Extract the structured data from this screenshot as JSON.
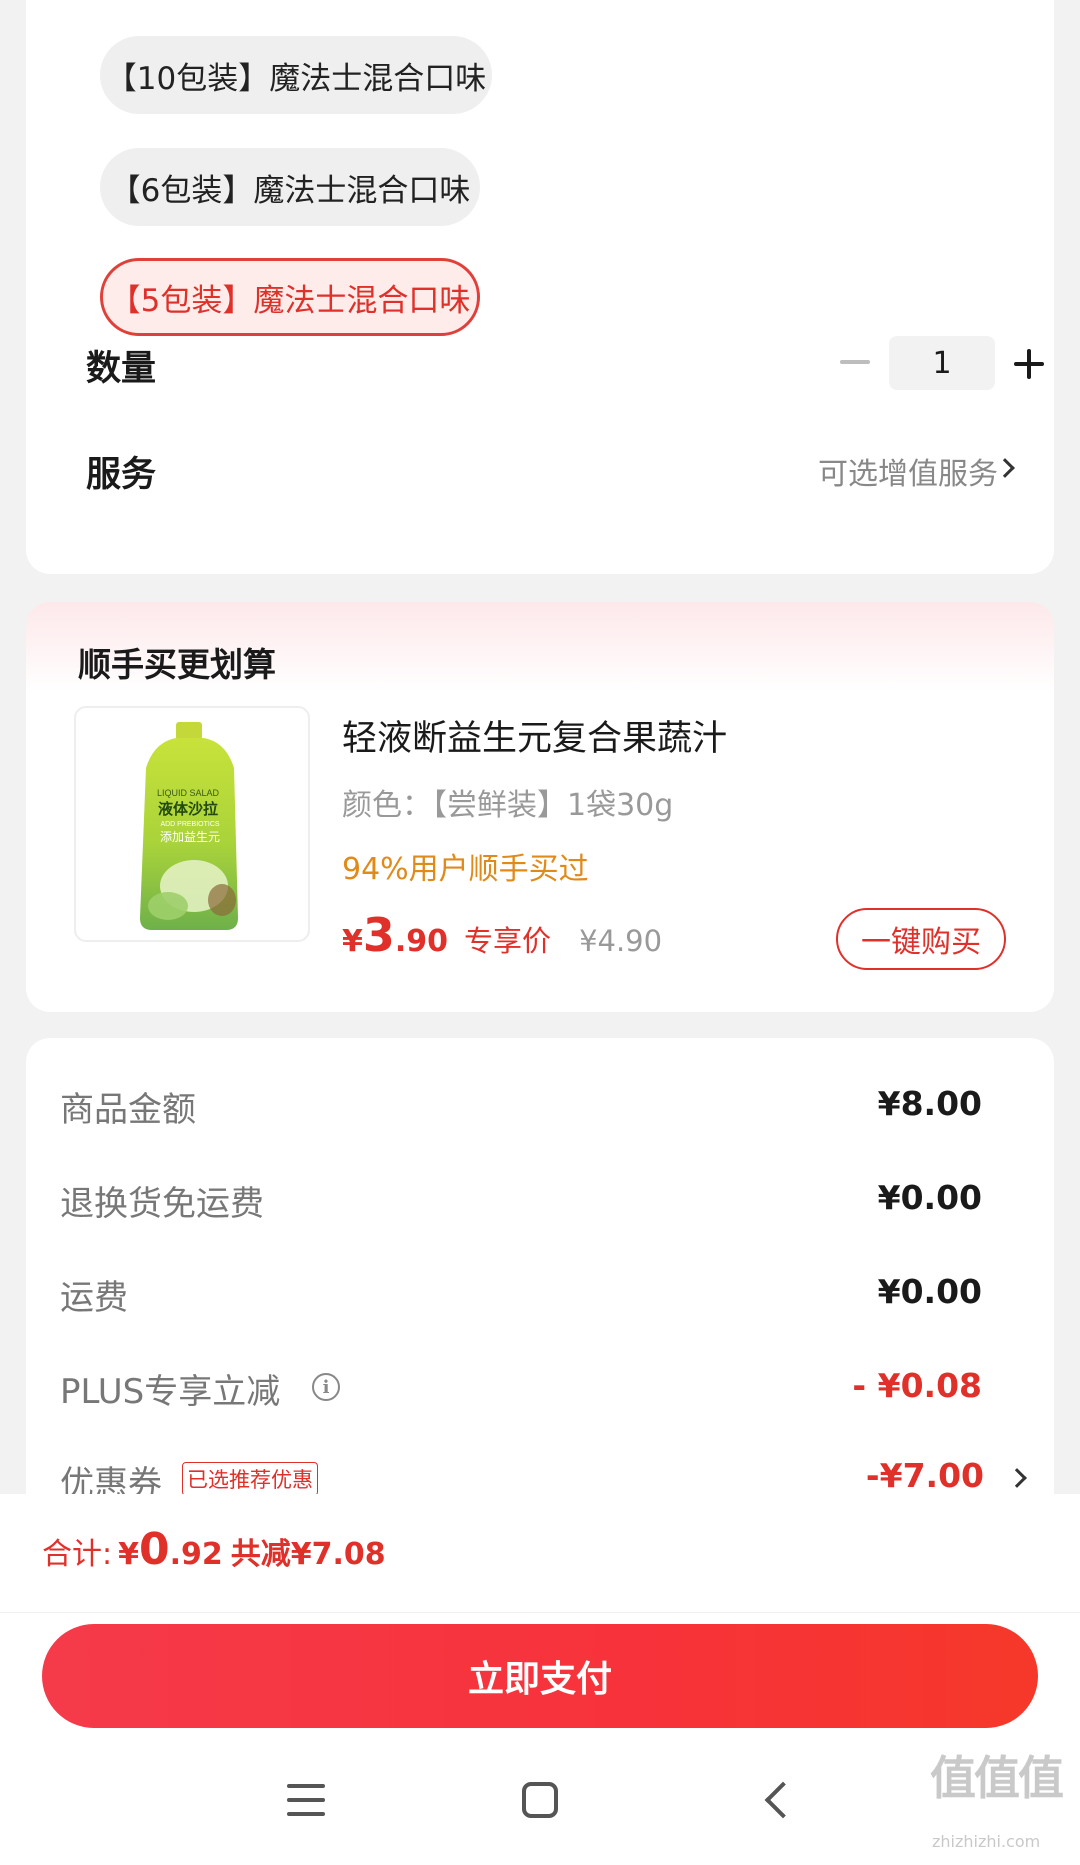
{
  "specs": {
    "options": [
      {
        "label": "【10包装】魔法士混合口味",
        "selected": false
      },
      {
        "label": "【6包装】魔法士混合口味",
        "selected": false
      },
      {
        "label": "【5包装】魔法士混合口味",
        "selected": true
      }
    ]
  },
  "quantity": {
    "label": "数量",
    "value": "1"
  },
  "service": {
    "label": "服务",
    "value": "可选增值服务"
  },
  "bundle": {
    "title": "顺手买更划算",
    "product_name": "轻液断益生元复合果蔬汁",
    "attribute": "颜色：【尝鲜装】1袋30g",
    "bought": "94%用户顺手买过",
    "price_currency": "¥",
    "price_int": "3",
    "price_dec": ".90",
    "price_tag": "专享价",
    "original_price": "¥4.90",
    "buy_label": "一键购买",
    "thumb_brand": "LIQUID SALAD",
    "thumb_name": "液体沙拉",
    "thumb_sub": "ADD PREBIOTICS",
    "thumb_tag": "添加益生元"
  },
  "fees": [
    {
      "label": "商品金额",
      "value": "¥8.00"
    },
    {
      "label": "退换货免运费",
      "value": "¥0.00"
    },
    {
      "label": "运费",
      "value": "¥0.00"
    },
    {
      "label": "PLUS专享立减",
      "value": "- ¥0.08"
    },
    {
      "label": "优惠券",
      "badge": "已选推荐优惠",
      "value": "-¥7.00"
    }
  ],
  "total": {
    "label": "合计:",
    "currency": "¥",
    "int": "0",
    "dec": ".92",
    "saving": "共减¥7.08"
  },
  "pay_button": "立即支付",
  "watermark": {
    "main": "值值值",
    "sub": "zhizhizhi.com"
  },
  "colors": {
    "accent": "#e0302a",
    "bought": "#e08a1a",
    "pay_gradient_start": "#f53a4a",
    "pay_gradient_end": "#f6382a"
  }
}
